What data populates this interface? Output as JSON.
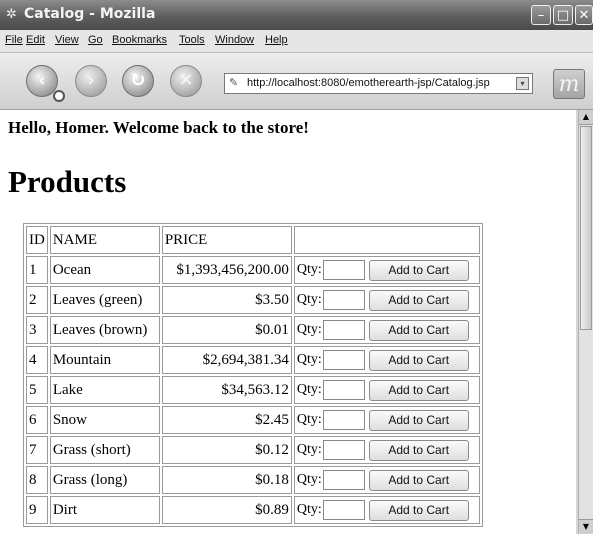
{
  "window": {
    "title": "Catalog - Mozilla"
  },
  "menu": [
    "File",
    "Edit",
    "View",
    "Go",
    "Bookmarks",
    "Tools",
    "Window",
    "Help"
  ],
  "toolbar": {
    "url": "http://localhost:8080/emotherearth-jsp/Catalog.jsp"
  },
  "page": {
    "greeting": "Hello, Homer. Welcome back to the store!",
    "heading": "Products"
  },
  "table": {
    "headers": [
      "ID",
      "NAME",
      "PRICE",
      ""
    ],
    "qty_label": "Qty:",
    "button_label": "Add to Cart",
    "rows": [
      {
        "id": "1",
        "name": "Ocean",
        "price": "$1,393,456,200.00"
      },
      {
        "id": "2",
        "name": "Leaves (green)",
        "price": "$3.50"
      },
      {
        "id": "3",
        "name": "Leaves (brown)",
        "price": "$0.01"
      },
      {
        "id": "4",
        "name": "Mountain",
        "price": "$2,694,381.34"
      },
      {
        "id": "5",
        "name": "Lake",
        "price": "$34,563.12"
      },
      {
        "id": "6",
        "name": "Snow",
        "price": "$2.45"
      },
      {
        "id": "7",
        "name": "Grass (short)",
        "price": "$0.12"
      },
      {
        "id": "8",
        "name": "Grass (long)",
        "price": "$0.18"
      },
      {
        "id": "9",
        "name": "Dirt",
        "price": "$0.89"
      }
    ]
  },
  "icons": {
    "back": "back-arrow-icon",
    "forward": "forward-arrow-icon",
    "reload": "reload-icon",
    "stop": "stop-icon"
  }
}
